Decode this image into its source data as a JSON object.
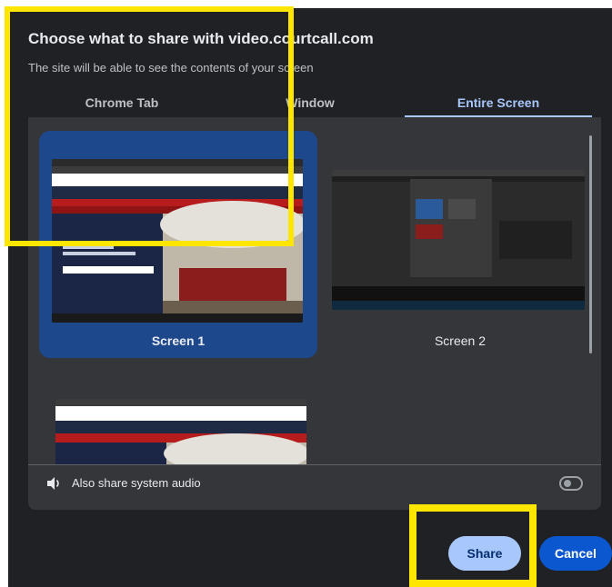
{
  "dialog": {
    "title": "Choose what to share with video.courtcall.com",
    "subtitle": "The site will be able to see the contents of your screen"
  },
  "tabs": [
    {
      "label": "Chrome Tab",
      "active": false
    },
    {
      "label": "Window",
      "active": false
    },
    {
      "label": "Entire Screen",
      "active": true
    }
  ],
  "screens": [
    {
      "label": "Screen 1",
      "selected": true
    },
    {
      "label": "Screen 2",
      "selected": false
    }
  ],
  "audio": {
    "label": "Also share system audio",
    "enabled": false,
    "icon": "speaker-icon"
  },
  "buttons": {
    "share_label": "Share",
    "cancel_label": "Cancel"
  },
  "colors": {
    "background": "#202124",
    "panel": "#35363a",
    "accent": "#a8c7fa",
    "primary": "#0b57d0",
    "highlight": "#fee600"
  }
}
